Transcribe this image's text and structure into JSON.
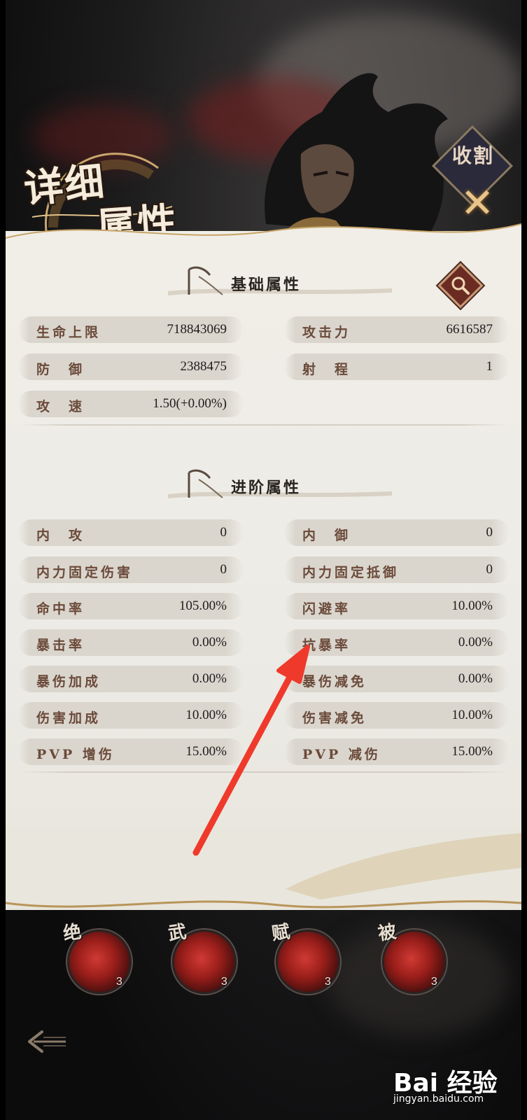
{
  "header": {
    "title_line1": "详细",
    "title_line2": "属性",
    "close_label": "收割",
    "close_icon": "x-icon"
  },
  "basic_section": {
    "title": "基础属性",
    "search_icon": "magnifier-icon",
    "stats": [
      {
        "label": "生命上限",
        "value": "718843069"
      },
      {
        "label": "攻击力",
        "value": "6616587"
      },
      {
        "label": "防　御",
        "value": "2388475"
      },
      {
        "label": "射　程",
        "value": "1"
      },
      {
        "label": "攻　速",
        "value": "1.50(+0.00%)"
      }
    ]
  },
  "advanced_section": {
    "title": "进阶属性",
    "stats": [
      {
        "label": "内　攻",
        "value": "0"
      },
      {
        "label": "内　御",
        "value": "0"
      },
      {
        "label": "内力固定伤害",
        "value": "0"
      },
      {
        "label": "内力固定抵御",
        "value": "0"
      },
      {
        "label": "命中率",
        "value": "105.00%"
      },
      {
        "label": "闪避率",
        "value": "10.00%"
      },
      {
        "label": "暴击率",
        "value": "0.00%"
      },
      {
        "label": "抗暴率",
        "value": "0.00%"
      },
      {
        "label": "暴伤加成",
        "value": "0.00%"
      },
      {
        "label": "暴伤减免",
        "value": "0.00%"
      },
      {
        "label": "伤害加成",
        "value": "10.00%"
      },
      {
        "label": "伤害减免",
        "value": "10.00%"
      },
      {
        "label": "PVP 增伤",
        "value": "15.00%"
      },
      {
        "label": "PVP 减伤",
        "value": "15.00%"
      }
    ]
  },
  "skills": [
    {
      "tag": "绝",
      "count": "3"
    },
    {
      "tag": "武",
      "count": "3"
    },
    {
      "tag": "赋",
      "count": "3"
    },
    {
      "tag": "被",
      "count": "3"
    }
  ],
  "footer": {
    "back_icon": "back-arrow-icon"
  },
  "watermark": {
    "logo": "Bai 经验",
    "url": "jingyan.baidu.com"
  },
  "colors": {
    "panel_bg": "#ecebe6",
    "label_color": "#6b4a3a",
    "annotation_arrow": "#ef3a2b"
  }
}
